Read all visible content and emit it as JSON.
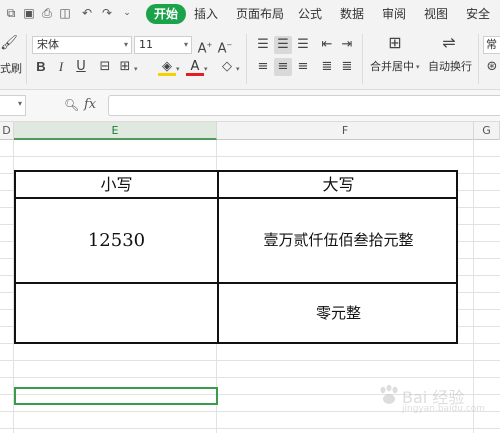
{
  "quick_access": {
    "icons": [
      "copy-icon",
      "print-icon",
      "print-preview-icon",
      "undo-icon",
      "redo-icon",
      "dropdown-icon"
    ]
  },
  "tabs": [
    {
      "label": "开始",
      "active": true
    },
    {
      "label": "插入"
    },
    {
      "label": "页面布局"
    },
    {
      "label": "公式"
    },
    {
      "label": "数据"
    },
    {
      "label": "审阅"
    },
    {
      "label": "视图"
    },
    {
      "label": "安全"
    }
  ],
  "ribbon": {
    "format_painter_label": "式刷",
    "font_name": "宋体",
    "font_size": "11",
    "merge_label": "合并居中",
    "wrap_label": "自动换行",
    "style_label": "常"
  },
  "formula_bar": {
    "fx_label": "fx",
    "value": ""
  },
  "columns": [
    "D",
    "E",
    "F",
    "G"
  ],
  "table": {
    "header_small": "小写",
    "header_large": "大写",
    "row1_small": "12530",
    "row1_large": "壹万贰仟伍佰叁拾元整",
    "row2_small": "",
    "row2_large": "零元整"
  },
  "watermark": {
    "text": "Bai 经验",
    "url": "jingyan.baidu.com"
  },
  "colors": {
    "accent": "#1aa34a",
    "active_cell_border": "#3c9a4b"
  }
}
